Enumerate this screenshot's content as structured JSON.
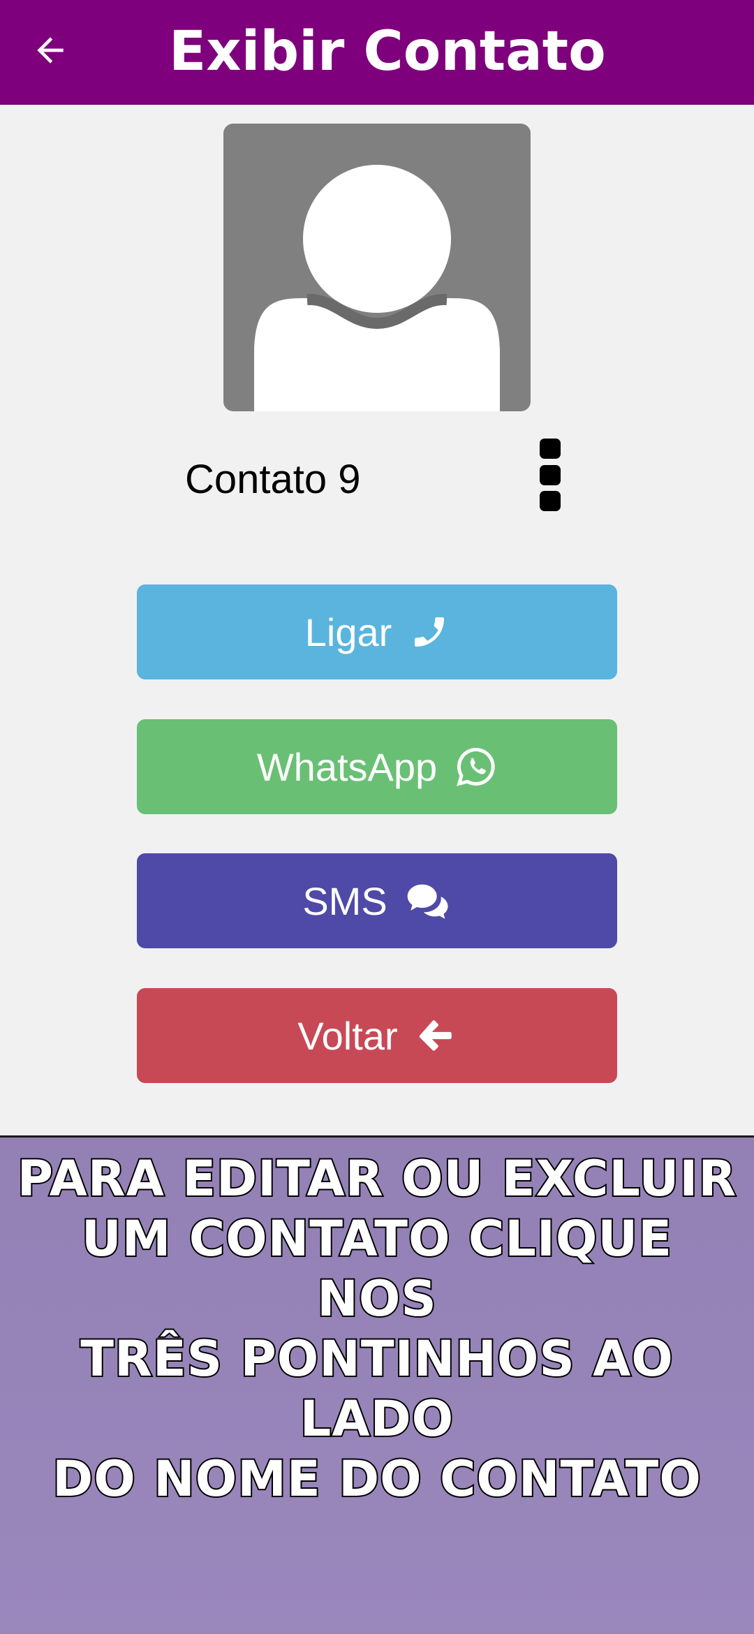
{
  "appbar": {
    "title": "Exibir Contato",
    "back_icon": "arrow-left-icon",
    "background": "#7e007c"
  },
  "contact": {
    "name": "Contato 9",
    "avatar_icon": "person-silhouette-icon",
    "menu_icon": "vertical-dots-icon"
  },
  "actions": {
    "call_label": "Ligar",
    "call_icon": "phone-icon",
    "whatsapp_label": "WhatsApp",
    "whatsapp_icon": "whatsapp-icon",
    "sms_label": "SMS",
    "sms_icon": "chat-bubbles-icon",
    "back_label": "Voltar",
    "back_icon": "arrow-left-bold-icon"
  },
  "colors": {
    "call": "#5ab4dd",
    "whatsapp": "#69c074",
    "sms": "#4f49a7",
    "back": "#c84956",
    "info_panel": "#9381b6"
  },
  "info": {
    "line1": "PARA EDITAR OU EXCLUIR",
    "line2": "UM CONTATO CLIQUE NOS",
    "line3": "TRÊS PONTINHOS AO LADO",
    "line4": "DO NOME DO CONTATO"
  }
}
